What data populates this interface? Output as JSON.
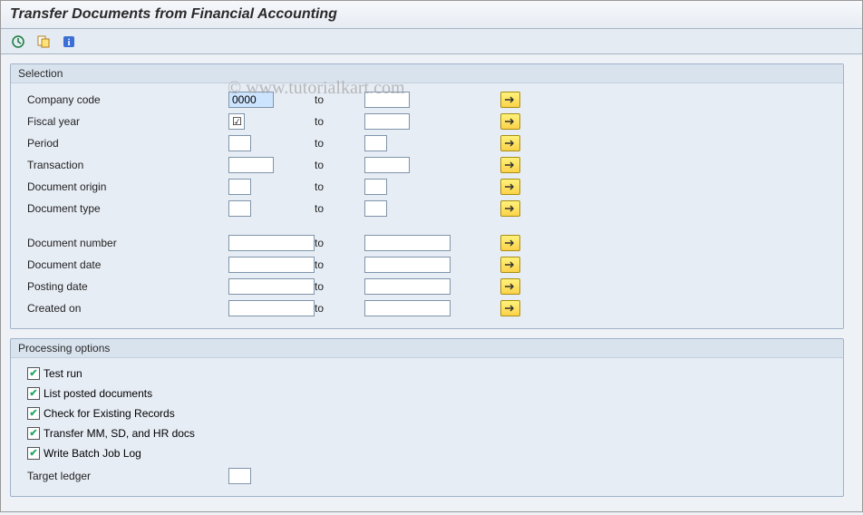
{
  "title": "Transfer Documents from Financial Accounting",
  "watermark": "© www.tutorialkart.com",
  "groups": {
    "selection": {
      "title": "Selection",
      "rows1": [
        {
          "label": "Company code",
          "from": "0000",
          "highlighted": true,
          "to_label": "to",
          "from_w": "w-code",
          "to_w": "w-code"
        },
        {
          "label": "Fiscal year",
          "from": "☑",
          "checkbox": true,
          "to_label": "to",
          "from_w": "w-cb",
          "to_w": "w-code"
        },
        {
          "label": "Period",
          "from": "",
          "to_label": "to",
          "from_w": "w-short",
          "to_w": "w-short"
        },
        {
          "label": "Transaction",
          "from": "",
          "to_label": "to",
          "from_w": "w-code",
          "to_w": "w-code"
        },
        {
          "label": "Document origin",
          "from": "",
          "to_label": "to",
          "from_w": "w-short",
          "to_w": "w-short"
        },
        {
          "label": "Document type",
          "from": "",
          "to_label": "to",
          "from_w": "w-short",
          "to_w": "w-short"
        }
      ],
      "rows2": [
        {
          "label": "Document number",
          "from": "",
          "to_label": "to",
          "from_w": "w-med",
          "to_w": "w-med"
        },
        {
          "label": "Document date",
          "from": "",
          "to_label": "to",
          "from_w": "w-med",
          "to_w": "w-med"
        },
        {
          "label": "Posting date",
          "from": "",
          "to_label": "to",
          "from_w": "w-med",
          "to_w": "w-med"
        },
        {
          "label": "Created on",
          "from": "",
          "to_label": "to",
          "from_w": "w-med",
          "to_w": "w-med"
        }
      ]
    },
    "processing": {
      "title": "Processing options",
      "checks": [
        "Test run",
        "List posted documents",
        "Check for Existing Records",
        "Transfer MM, SD, and HR docs",
        "Write Batch Job Log"
      ],
      "target_ledger_label": "Target ledger"
    }
  }
}
